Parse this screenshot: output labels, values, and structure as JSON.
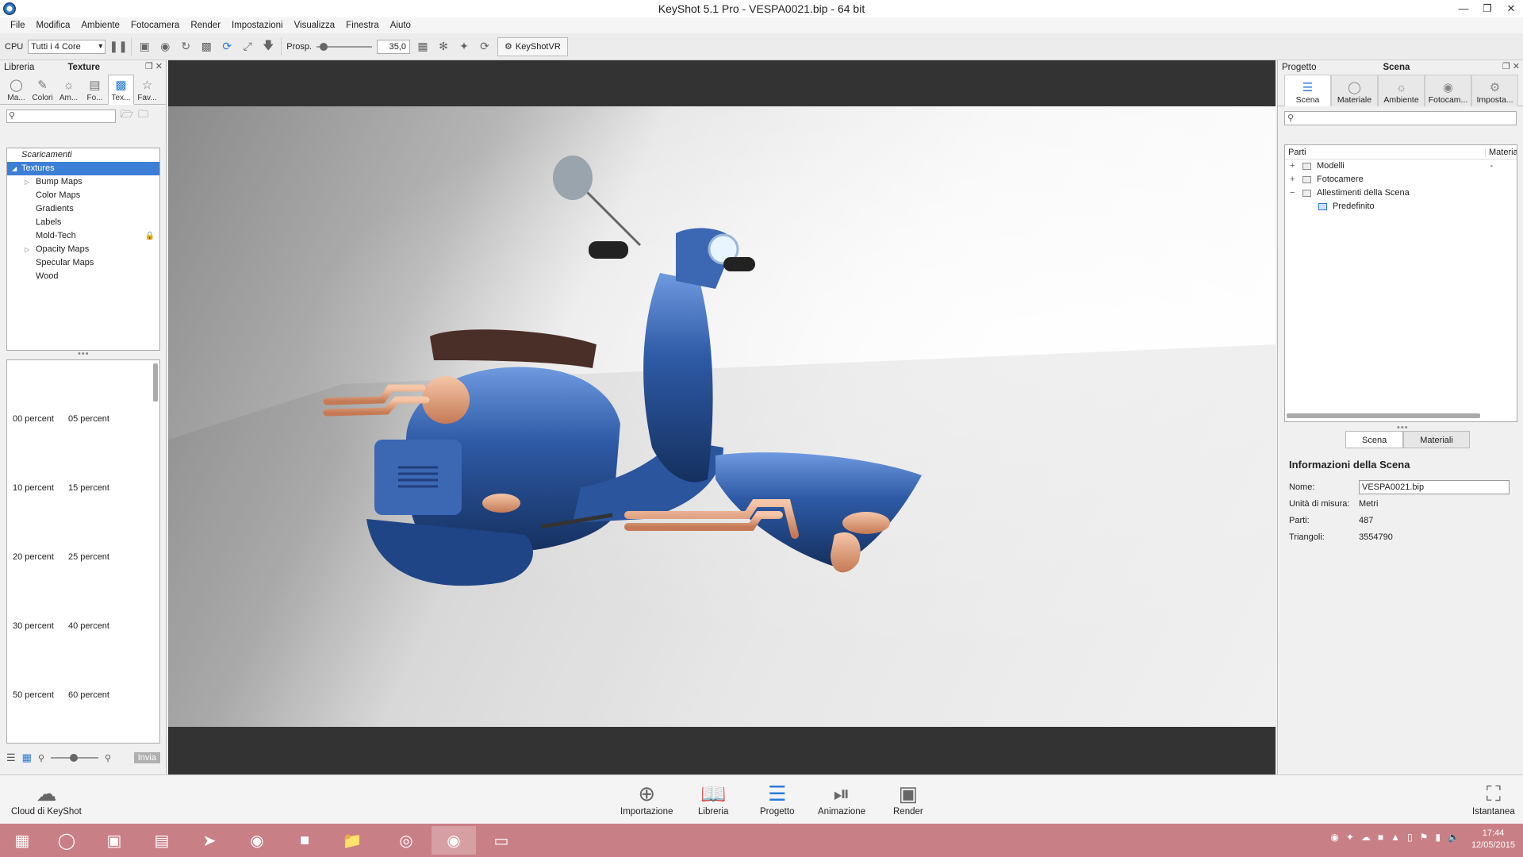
{
  "window": {
    "title": "KeyShot 5.1 Pro  - VESPA0021.bip  - 64 bit"
  },
  "menu": [
    "File",
    "Modifica",
    "Ambiente",
    "Fotocamera",
    "Render",
    "Impostazioni",
    "Visualizza",
    "Finestra",
    "Aiuto"
  ],
  "toolbar": {
    "cpu_label": "CPU",
    "cores_value": "Tutti i 4 Core",
    "perspective_label": "Prosp.",
    "perspective_value": "35,0",
    "keyshotvr_label": "KeyShotVR"
  },
  "library": {
    "header_left": "Libreria",
    "header_title": "Texture",
    "tabs": [
      "Ma...",
      "Colori",
      "Am...",
      "Fo...",
      "Tex...",
      "Fav..."
    ],
    "tree_root": "Scaricamenti",
    "tree_selected": "Textures",
    "tree_items": [
      "Bump Maps",
      "Color Maps",
      "Gradients",
      "Labels",
      "Mold-Tech",
      "Opacity Maps",
      "Specular Maps",
      "Wood"
    ],
    "thumbnails": [
      "00 percent",
      "05 percent",
      "10 percent",
      "15 percent",
      "20 percent",
      "25 percent",
      "30 percent",
      "40 percent",
      "50 percent",
      "60 percent"
    ],
    "send_label": "Invia"
  },
  "project": {
    "header_left": "Progetto",
    "header_title": "Scena",
    "tabs": [
      "Scena",
      "Materiale",
      "Ambiente",
      "Fotocam...",
      "Imposta..."
    ],
    "parts_col1": "Parti",
    "parts_col2": "Materia",
    "parts": [
      {
        "label": "Modelli",
        "value": "-"
      },
      {
        "label": "Fotocamere",
        "value": ""
      },
      {
        "label": "Allestimenti della Scena",
        "value": ""
      }
    ],
    "parts_child": "Predefinito",
    "subtabs": [
      "Scena",
      "Materiali"
    ],
    "info_title": "Informazioni della Scena",
    "info": {
      "name_label": "Nome:",
      "name_value": "VESPA0021.bip",
      "units_label": "Unità di misura:",
      "units_value": "Metri",
      "parts_label": "Parti:",
      "parts_value": "487",
      "triangles_label": "Triangoli:",
      "triangles_value": "3554790"
    }
  },
  "actions": {
    "cloud": "Cloud di KeyShot",
    "import": "Importazione",
    "library": "Libreria",
    "project": "Progetto",
    "animation": "Animazione",
    "render": "Render",
    "snapshot": "Istantanea"
  },
  "taskbar": {
    "time": "17:44",
    "date": "12/05/2015"
  },
  "colors": {
    "accent": "#2a7ad8",
    "taskbar": "#c97f86",
    "scooter": "#2e5aa6"
  }
}
